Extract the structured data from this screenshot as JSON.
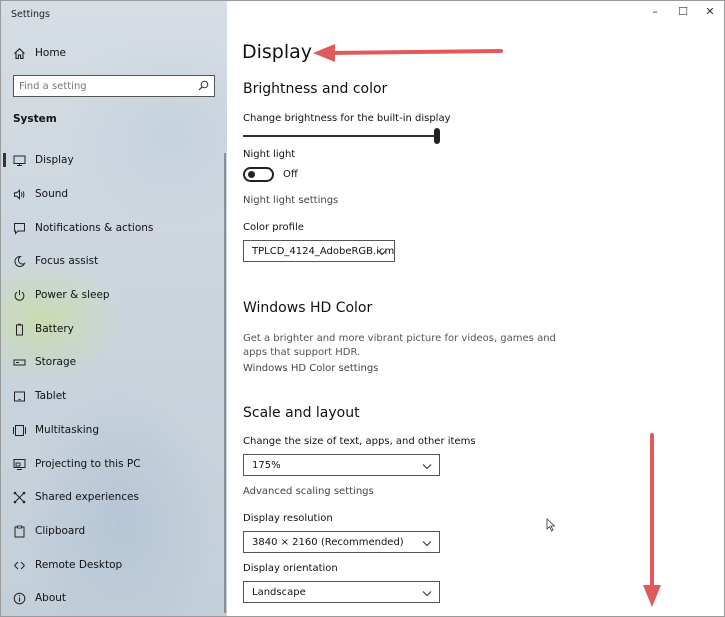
{
  "window": {
    "title": "Settings",
    "minimize": "–",
    "maximize": "☐",
    "close": "✕"
  },
  "sidebar": {
    "home_label": "Home",
    "search_placeholder": "Find a setting",
    "section": "System",
    "items": [
      {
        "label": "Display",
        "icon": "monitor-icon",
        "active": true
      },
      {
        "label": "Sound",
        "icon": "speaker-icon"
      },
      {
        "label": "Notifications & actions",
        "icon": "notification-icon"
      },
      {
        "label": "Focus assist",
        "icon": "moon-icon"
      },
      {
        "label": "Power & sleep",
        "icon": "power-icon"
      },
      {
        "label": "Battery",
        "icon": "battery-icon"
      },
      {
        "label": "Storage",
        "icon": "storage-icon"
      },
      {
        "label": "Tablet",
        "icon": "tablet-icon"
      },
      {
        "label": "Multitasking",
        "icon": "multitasking-icon"
      },
      {
        "label": "Projecting to this PC",
        "icon": "projecting-icon"
      },
      {
        "label": "Shared experiences",
        "icon": "shared-experiences-icon"
      },
      {
        "label": "Clipboard",
        "icon": "clipboard-icon"
      },
      {
        "label": "Remote Desktop",
        "icon": "remote-desktop-icon"
      },
      {
        "label": "About",
        "icon": "info-icon"
      }
    ]
  },
  "main": {
    "title": "Display",
    "brightness": {
      "heading": "Brightness and color",
      "slider_label": "Change brightness for the built-in display",
      "value_fraction": 1.0
    },
    "night_light": {
      "label": "Night light",
      "state_text": "Off",
      "settings_link": "Night light settings"
    },
    "color_profile": {
      "label": "Color profile",
      "value": "TPLCD_4124_AdobeRGB.icm"
    },
    "hd_color": {
      "heading": "Windows HD Color",
      "description": "Get a brighter and more vibrant picture for videos, games and apps that support HDR.",
      "settings_link": "Windows HD Color settings"
    },
    "scale": {
      "heading": "Scale and layout",
      "size_label": "Change the size of text, apps, and other items",
      "size_value": "175%",
      "advanced_link": "Advanced scaling settings",
      "resolution_label": "Display resolution",
      "resolution_value": "3840 × 2160 (Recommended)",
      "orientation_label": "Display orientation",
      "orientation_value": "Landscape"
    }
  },
  "colors": {
    "annotation_arrow": "#e05a5a",
    "sidebar_bg": "#cdd6df"
  }
}
